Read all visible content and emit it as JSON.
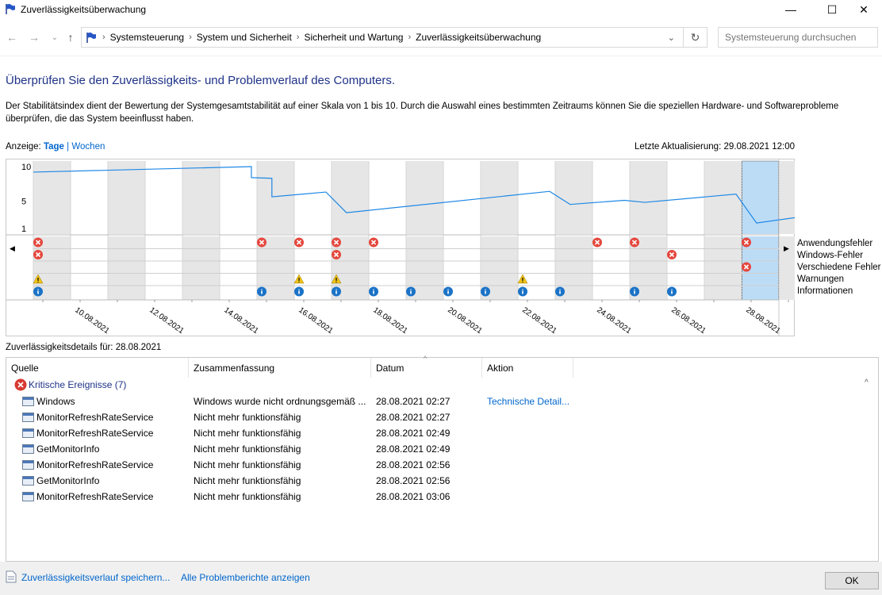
{
  "window": {
    "title": "Zuverlässigkeitsüberwachung",
    "minimize": "—",
    "maximize": "☐",
    "close": "✕"
  },
  "nav": {
    "back": "←",
    "forward": "→",
    "recent": "⌄",
    "up": "↑",
    "breadcrumbs": [
      "Systemsteuerung",
      "System und Sicherheit",
      "Sicherheit und Wartung",
      "Zuverlässigkeitsüberwachung"
    ],
    "search_placeholder": "Systemsteuerung durchsuchen"
  },
  "header": {
    "title": "Überprüfen Sie den Zuverlässigkeits- und Problemverlauf des Computers.",
    "description": "Der Stabilitätsindex dient der Bewertung der Systemgesamtstabilität auf einer Skala von 1 bis 10. Durch die Auswahl eines bestimmten Zeitraums können Sie die speziellen Hardware- und Softwareprobleme überprüfen, die das System beeinflusst haben.",
    "view_label": "Anzeige:",
    "view_days": "Tage",
    "view_sep": "|",
    "view_weeks": "Wochen",
    "last_update": "Letzte Aktualisierung: 29.08.2021 12:00"
  },
  "chart_data": {
    "type": "line",
    "y_ticks": [
      "10",
      "5",
      "1"
    ],
    "ylim": [
      1,
      10
    ],
    "date_labels": [
      "10.08.2021",
      "12.08.2021",
      "14.08.2021",
      "16.08.2021",
      "18.08.2021",
      "20.08.2021",
      "22.08.2021",
      "24.08.2021",
      "26.08.2021",
      "28.08.2021"
    ],
    "columns": [
      "09.08.",
      "10.08.",
      "11.08.",
      "12.08.",
      "13.08.",
      "14.08.",
      "15.08.",
      "16.08.",
      "17.08.",
      "18.08.",
      "19.08.",
      "20.08.",
      "21.08.",
      "22.08.",
      "23.08.",
      "24.08.",
      "25.08.",
      "26.08.",
      "27.08.",
      "28.08.",
      "29.08."
    ],
    "selected_column": 19,
    "stability_series": {
      "name": "Stabilitätsindex",
      "x": [
        0,
        5.85,
        5.85,
        6.4,
        6.4,
        7.85,
        7.85,
        8.4,
        8.4,
        13.85,
        13.85,
        14.4,
        14.4,
        15.85,
        15.85,
        16.4,
        16.4,
        18.85,
        18.85,
        19.4,
        19.4,
        21
      ],
      "y": [
        9.2,
        10.0,
        8.4,
        8.3,
        5.6,
        6.3,
        6.3,
        3.3,
        3.3,
        6.4,
        6.4,
        4.5,
        4.5,
        5.1,
        5.1,
        4.8,
        4.8,
        6.0,
        6.0,
        1.8,
        1.8,
        3.0
      ]
    },
    "legend_rows": [
      "Anwendungsfehler",
      "Windows-Fehler",
      "Verschiedene Fehler",
      "Warnungen",
      "Informationen"
    ],
    "events": [
      {
        "row": 0,
        "cols": [
          0,
          6,
          7,
          8,
          9,
          15,
          16,
          19
        ],
        "kind": "error"
      },
      {
        "row": 1,
        "cols": [
          0,
          8,
          17
        ],
        "kind": "error"
      },
      {
        "row": 2,
        "cols": [
          19
        ],
        "kind": "error"
      },
      {
        "row": 3,
        "cols": [
          0,
          7,
          8,
          13
        ],
        "kind": "warning"
      },
      {
        "row": 4,
        "cols": [
          0,
          6,
          7,
          8,
          9,
          10,
          11,
          12,
          13,
          14,
          16,
          17
        ],
        "kind": "info"
      }
    ],
    "colors": {
      "line": "#1e88e5",
      "shade": "#e6e6e6",
      "selected": "#bcdcf6",
      "error": "#e5473d",
      "warning": "#f0c419",
      "info": "#1a73c7"
    }
  },
  "details": {
    "label": "Zuverlässigkeitsdetails für: 28.08.2021",
    "columns": [
      "Quelle",
      "Zusammenfassung",
      "Datum",
      "Aktion"
    ],
    "group": "Kritische Ereignisse (7)",
    "rows": [
      {
        "source": "Windows",
        "summary": "Windows wurde nicht ordnungsgemäß ...",
        "date": "28.08.2021 02:27",
        "action": "Technische Detail..."
      },
      {
        "source": "MonitorRefreshRateService",
        "summary": "Nicht mehr funktionsfähig",
        "date": "28.08.2021 02:27",
        "action": ""
      },
      {
        "source": "MonitorRefreshRateService",
        "summary": "Nicht mehr funktionsfähig",
        "date": "28.08.2021 02:49",
        "action": ""
      },
      {
        "source": "GetMonitorInfo",
        "summary": "Nicht mehr funktionsfähig",
        "date": "28.08.2021 02:49",
        "action": ""
      },
      {
        "source": "MonitorRefreshRateService",
        "summary": "Nicht mehr funktionsfähig",
        "date": "28.08.2021 02:56",
        "action": ""
      },
      {
        "source": "GetMonitorInfo",
        "summary": "Nicht mehr funktionsfähig",
        "date": "28.08.2021 02:56",
        "action": ""
      },
      {
        "source": "MonitorRefreshRateService",
        "summary": "Nicht mehr funktionsfähig",
        "date": "28.08.2021 03:06",
        "action": ""
      }
    ]
  },
  "footer": {
    "save_link": "Zuverlässigkeitsverlauf speichern...",
    "reports_link": "Alle Problemberichte anzeigen",
    "ok": "OK"
  }
}
